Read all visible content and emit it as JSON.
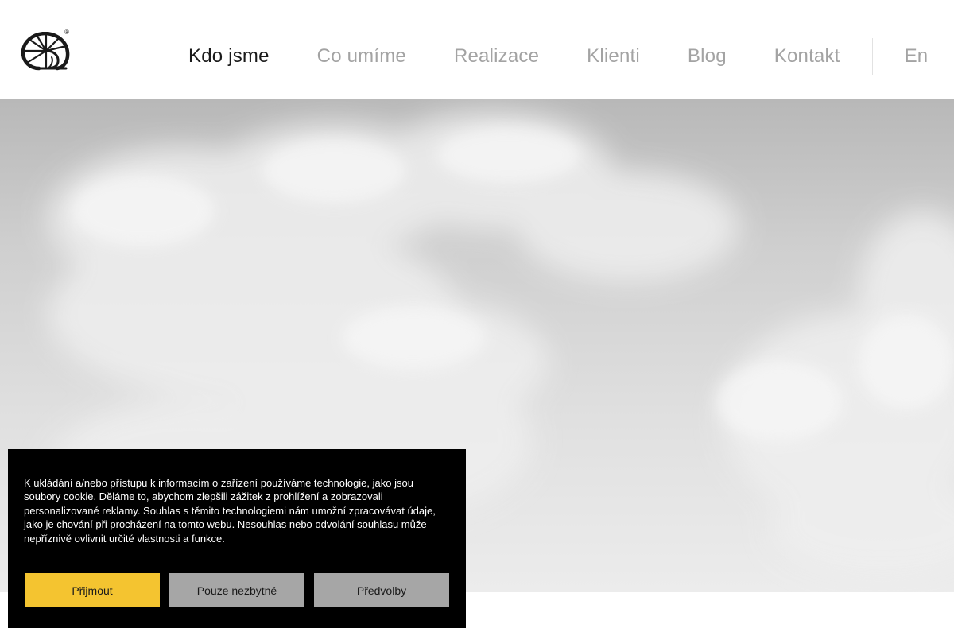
{
  "brand": {
    "logo_icon": "nautilus-shell-icon",
    "registered_mark": "®"
  },
  "nav": {
    "items": [
      {
        "label": "Kdo jsme",
        "active": true
      },
      {
        "label": "Co umíme",
        "active": false
      },
      {
        "label": "Realizace",
        "active": false
      },
      {
        "label": "Klienti",
        "active": false
      },
      {
        "label": "Blog",
        "active": false
      },
      {
        "label": "Kontakt",
        "active": false
      }
    ],
    "language": "En"
  },
  "cookie_banner": {
    "text": "K ukládání a/nebo přístupu k informacím o zařízení používáme technologie, jako jsou soubory cookie. Děláme to, abychom zlepšili zážitek z prohlížení a zobrazovali personalizované reklamy. Souhlas s těmito technologiemi nám umožní zpracovávat údaje, jako je chování při procházení na tomto webu. Nesouhlas nebo odvolání souhlasu může nepříznivě ovlivnit určité vlastnosti a funkce.",
    "accept_label": "Přijmout",
    "necessary_label": "Pouze nezbytné",
    "preferences_label": "Předvolby"
  },
  "colors": {
    "accent": "#f4c430",
    "banner_bg": "#000000",
    "nav_active": "#1a1a1a",
    "nav_inactive": "#a3a3a3",
    "secondary_button": "#a6a6a6"
  }
}
